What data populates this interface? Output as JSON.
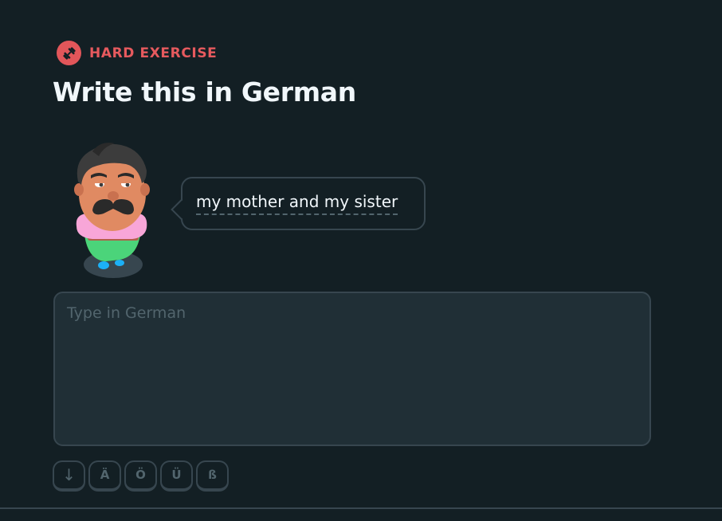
{
  "exercise": {
    "badge_label": "HARD EXERCISE",
    "badge_icon": "dumbbell-icon",
    "badge_color": "#e2565a",
    "title": "Write this in German"
  },
  "prompt": {
    "character": "mustached-man-character",
    "text": "my mother and my sister"
  },
  "answer": {
    "placeholder": "Type in German",
    "value": ""
  },
  "special_keys": [
    {
      "label": "↓",
      "name": "collapse-keys-button"
    },
    {
      "label": "Ä",
      "name": "key-a-umlaut"
    },
    {
      "label": "Ö",
      "name": "key-o-umlaut"
    },
    {
      "label": "Ü",
      "name": "key-u-umlaut"
    },
    {
      "label": "ß",
      "name": "key-eszett"
    }
  ],
  "colors": {
    "background": "#131f24",
    "accent_red": "#e65a5e",
    "border": "#37464f",
    "input_bg": "#202f36",
    "muted_text": "#52656d"
  }
}
